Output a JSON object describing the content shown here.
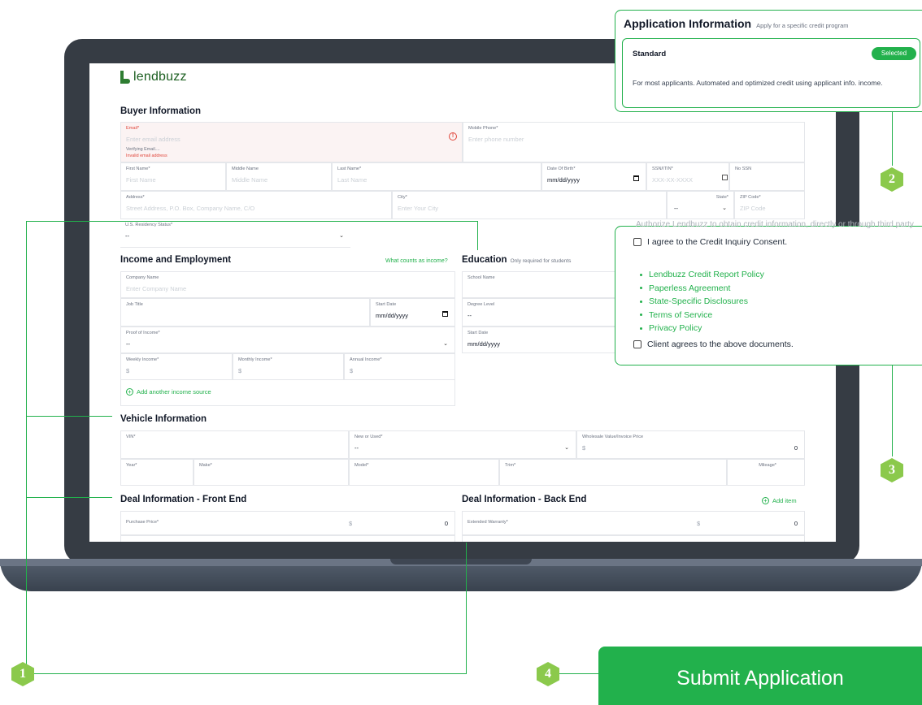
{
  "brand": {
    "logo_text": "lendbuzz"
  },
  "buyer": {
    "title": "Buyer Information",
    "email_label": "Email*",
    "email_placeholder": "Enter email address",
    "verifying": "Verifying Email....",
    "invalid": "Invalid email address",
    "mobile_label": "Mobile Phone*",
    "mobile_placeholder": "Enter phone number",
    "first_label": "First Name*",
    "first_placeholder": "First Name",
    "middle_label": "Middle Name",
    "middle_placeholder": "Middle Name",
    "last_label": "Last Name*",
    "last_placeholder": "Last Name",
    "dob_label": "Date Of Birth*",
    "dob_value": "mm/dd/yyyy",
    "ssn_label": "SSN/ITIN*",
    "ssn_placeholder": "XXX-XX-XXXX",
    "nossn_label": "No SSN",
    "address_label": "Address*",
    "address_placeholder": "Street Address, P.O. Box, Company Name, C/O",
    "city_label": "City*",
    "city_placeholder": "Enter Your City",
    "state_label": "State*",
    "state_value": "--",
    "zip_label": "ZIP Code*",
    "zip_placeholder": "ZIP Code",
    "residency_label": "U.S. Residency Status*",
    "residency_value": "--"
  },
  "income": {
    "title": "Income and Employment",
    "help_link": "What counts as income?",
    "company_label": "Company Name",
    "company_placeholder": "Enter Company Name",
    "job_label": "Job Title",
    "start_label": "Start Date",
    "start_value": "mm/dd/yyyy",
    "proof_label": "Proof of Income*",
    "proof_value": "--",
    "weekly_label": "Weekly Income*",
    "monthly_label": "Monthly Income*",
    "annual_label": "Annual Income*",
    "currency": "$",
    "add_source": "Add another income source"
  },
  "education": {
    "title": "Education",
    "subtitle": "Only required for students",
    "school_label": "School Name",
    "degree_label": "Degree Level",
    "degree_value": "--",
    "start_label": "Start Date",
    "start_value": "mm/dd/yyyy"
  },
  "vehicle": {
    "title": "Vehicle Information",
    "vin_label": "VIN*",
    "new_used_label": "New or Used*",
    "new_used_value": "--",
    "wholesale_label": "Wholesale Value/Invoice Price",
    "wholesale_currency": "$",
    "wholesale_value": "0",
    "year_label": "Year*",
    "make_label": "Make*",
    "model_label": "Model*",
    "trim_label": "Trim*",
    "mileage_label": "Mileage*"
  },
  "deal": {
    "front_title": "Deal Information - Front End",
    "back_title": "Deal Information - Back End",
    "add_item": "Add item",
    "purchase_label": "Purchase Price*",
    "purchase_currency": "$",
    "purchase_value": "0",
    "warranty_label": "Extended Warranty*",
    "warranty_currency": "$",
    "warranty_value": "0"
  },
  "app_info": {
    "title": "Application Information",
    "subtitle": "Apply for a specific credit program",
    "option_title": "Standard",
    "option_badge": "Selected",
    "option_desc": "For most applicants. Automated and optimized credit using applicant info. income."
  },
  "consent": {
    "cut_text": "Authorize Lendbuzz to obtain credit information, directly or through third party",
    "credit_inquiry": "I agree to the Credit Inquiry Consent.",
    "policies": [
      "Lendbuzz Credit Report Policy",
      "Paperless Agreement",
      "State-Specific Disclosures",
      "Terms of Service",
      "Privacy Policy"
    ],
    "client_agrees": "Client agrees to the above documents."
  },
  "callouts": {
    "one": "1",
    "two": "2",
    "three": "3",
    "four": "4"
  },
  "submit": {
    "label": "Submit Application"
  },
  "colors": {
    "accent": "#22b14c",
    "error": "#e0463b",
    "laptop": "#363c44"
  }
}
